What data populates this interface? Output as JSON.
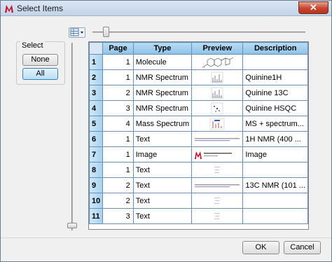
{
  "window": {
    "title": "Select Items",
    "close_glyph": "✕"
  },
  "select_group": {
    "label": "Select",
    "none_label": "None",
    "all_label": "All"
  },
  "grid": {
    "columns": [
      "Page",
      "Type",
      "Preview",
      "Description"
    ],
    "rows": [
      {
        "num": "1",
        "page": "1",
        "type": "Molecule",
        "preview": "molecule-structure",
        "description": ""
      },
      {
        "num": "2",
        "page": "1",
        "type": "NMR Spectrum",
        "preview": "nmr-spectrum",
        "description": "Quinine1H"
      },
      {
        "num": "3",
        "page": "2",
        "type": "NMR Spectrum",
        "preview": "nmr-spectrum",
        "description": "Quinine 13C"
      },
      {
        "num": "4",
        "page": "3",
        "type": "NMR Spectrum",
        "preview": "nmr-2d",
        "description": "Quinine HSQC"
      },
      {
        "num": "5",
        "page": "4",
        "type": "Mass Spectrum",
        "preview": "mass-spectrum",
        "description": "MS + spectrum..."
      },
      {
        "num": "6",
        "page": "1",
        "type": "Text",
        "preview": "text-line",
        "description": "1H NMR (400 ..."
      },
      {
        "num": "7",
        "page": "1",
        "type": "Image",
        "preview": "mestrelab-logo",
        "description": "Image"
      },
      {
        "num": "8",
        "page": "1",
        "type": "Text",
        "preview": "text-faint",
        "description": ""
      },
      {
        "num": "9",
        "page": "2",
        "type": "Text",
        "preview": "text-line",
        "description": "13C NMR (101 ..."
      },
      {
        "num": "10",
        "page": "2",
        "type": "Text",
        "preview": "text-faint",
        "description": ""
      },
      {
        "num": "11",
        "page": "3",
        "type": "Text",
        "preview": "text-faint",
        "description": ""
      }
    ]
  },
  "buttons": {
    "ok_label": "OK",
    "cancel_label": "Cancel"
  },
  "colors": {
    "header_blue": "#8cc3e8",
    "grid_line": "#6b8fb4",
    "brand_red": "#c8102e"
  }
}
